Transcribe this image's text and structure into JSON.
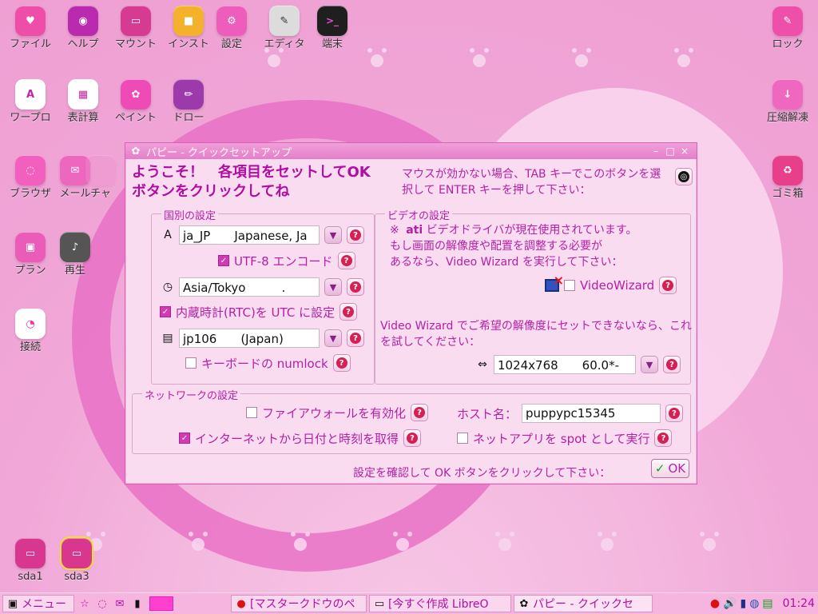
{
  "desktop": {
    "icons": [
      {
        "label": "ファイル",
        "name": "file-manager-icon",
        "color": "#ee4ea7",
        "glyph": "♥"
      },
      {
        "label": "ヘルプ",
        "name": "help-icon",
        "color": "#b92aae",
        "glyph": "◉"
      },
      {
        "label": "マウント",
        "name": "mount-icon",
        "color": "#d63a91",
        "glyph": "▭"
      },
      {
        "label": "インスト",
        "name": "install-icon",
        "color": "#f4b12b",
        "glyph": "■"
      },
      {
        "label": "設定",
        "name": "settings-icon",
        "color": "#ef5dbc",
        "glyph": "⚙"
      },
      {
        "label": "エディタ",
        "name": "editor-icon",
        "color": "#dcdcdc",
        "glyph": "✎"
      },
      {
        "label": "端末",
        "name": "terminal-icon",
        "color": "#1f1f1f",
        "glyph": ">_"
      },
      {
        "label": "ロック",
        "name": "lock-icon",
        "color": "#ed4fa9",
        "glyph": "✎"
      },
      {
        "label": "ワープロ",
        "name": "word-processor-icon",
        "color": "#ffffff",
        "glyph": "A"
      },
      {
        "label": "表計算",
        "name": "spreadsheet-icon",
        "color": "#ffffff",
        "glyph": "▦"
      },
      {
        "label": "ペイント",
        "name": "paint-icon",
        "color": "#ef4bb7",
        "glyph": "✿"
      },
      {
        "label": "ドロー",
        "name": "draw-icon",
        "color": "#9c3aac",
        "glyph": "✏"
      },
      {
        "label": "圧縮解凍",
        "name": "archive-icon",
        "color": "#ef67bf",
        "glyph": "↓"
      },
      {
        "label": "ブラウザ",
        "name": "browser-icon",
        "color": "#f25fbf",
        "glyph": "◌"
      },
      {
        "label": "メール",
        "name": "mail-icon",
        "color": "#ee67bf",
        "glyph": "✉"
      },
      {
        "label": "チャ",
        "name": "chat-icon",
        "color": "#ef8fd0",
        "glyph": ""
      },
      {
        "label": "ゴミ箱",
        "name": "trash-icon",
        "color": "#e73f8a",
        "glyph": "♻"
      },
      {
        "label": "プラン",
        "name": "planner-icon",
        "color": "#ea5cb8",
        "glyph": "▣"
      },
      {
        "label": "再生",
        "name": "player-icon",
        "color": "#555555",
        "glyph": "♪"
      },
      {
        "label": "接続",
        "name": "connect-icon",
        "color": "#ffffff",
        "glyph": "◔"
      },
      {
        "label": "sda1",
        "name": "drive-sda1-icon",
        "color": "#d8368f",
        "glyph": "▭"
      },
      {
        "label": "sda3",
        "name": "drive-sda3-icon",
        "color": "#d8368f",
        "glyph": "▭"
      }
    ]
  },
  "window": {
    "title": "パピー - クイックセットアップ",
    "controls": {
      "minimize": "–",
      "maximize": "□",
      "close": "×"
    },
    "hero": "ようこそ！　各項目をセットしてOKボタンをクリックしてね",
    "hint_tab": "マウスが効かない場合、TAB キーでこのボタンを選択して ENTER キーを押して下さい：",
    "hint_tab_b1": "TAB",
    "hint_tab_b2": "ENTER",
    "country_group": "国別の設定",
    "locale_value": "ja_JP　　Japanese, Ja",
    "utf8_label": "UTF-8 エンコード",
    "timezone_value": "Asia/Tokyo　　　.",
    "rtc_label": "内蔵時計(RTC)を UTC に設定",
    "keyboard_value": "jp106　　(Japan)",
    "numlock_label": "キーボードの numlock",
    "video_group": "ビデオの設定",
    "video_message_1": "※",
    "video_message_2": "ati",
    "video_message_3": "ビデオドライバが現在使用されています。",
    "video_message_4": "もし画面の解像度や配置を調整する必要が",
    "video_message_5": "あるなら、Video Wizard を実行して下さい：",
    "videowizard_label": "VideoWizard",
    "video_note": "Video Wizard でご希望の解像度にセットできないなら、これを試してください：",
    "resolution_value": "1024x768　　60.0*-",
    "network_group": "ネットワークの設定",
    "firewall_label": "ファイアウォールを有効化",
    "hostname_label": "ホスト名：",
    "hostname_value": "puppypc15345",
    "internet_time_label": "インターネットから日付と時刻を取得",
    "netapps_label": "ネットアプリを spot として実行",
    "footer": "設定を確認して OK ボタンをクリックして下さい：",
    "ok_label": "OK",
    "help_glyph": "?",
    "dropdown_glyph": "▼",
    "check_glyph": "✓"
  },
  "taskbar": {
    "menu_label": "メニュー",
    "windows": [
      {
        "label": "[マスタークドウのペ",
        "icon": "stop-icon"
      },
      {
        "label": "[今すぐ作成 LibreO",
        "icon": "window-icon"
      },
      {
        "label": "パピー - クイックセ",
        "icon": "puppy-icon"
      }
    ],
    "clock": "01:24"
  }
}
